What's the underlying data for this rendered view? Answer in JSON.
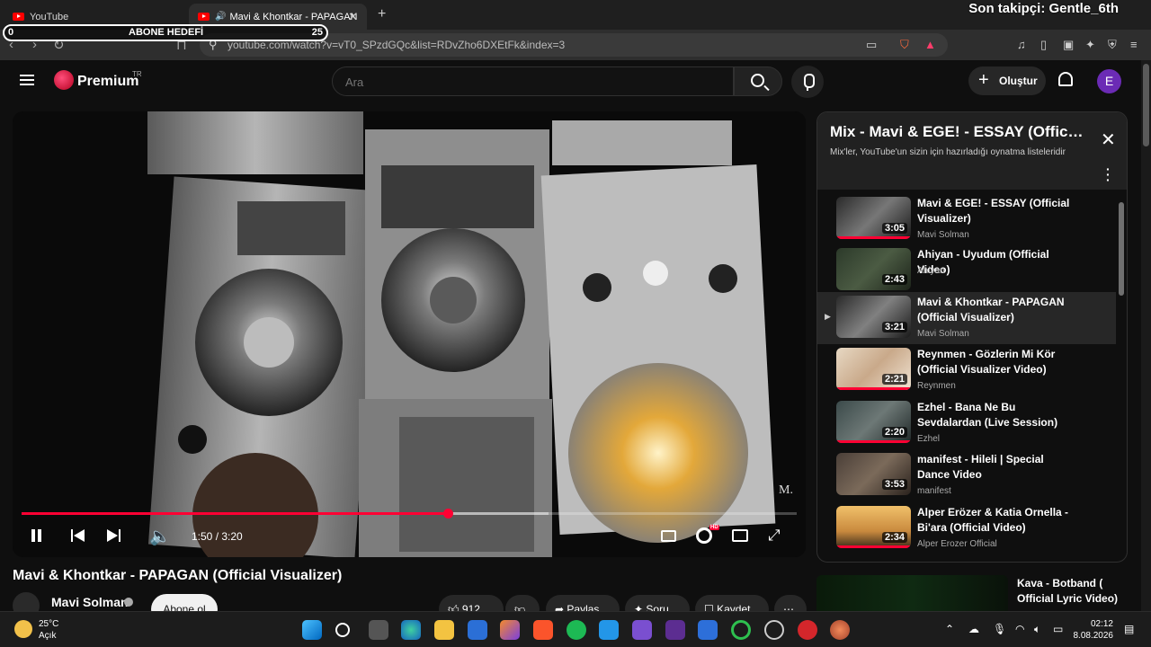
{
  "browser": {
    "tabs": [
      {
        "title": "YouTube"
      },
      {
        "title": "Mavi & Khontkar - PAPAGAN"
      }
    ],
    "new_tab": "+",
    "tab_close": "✕",
    "url": "youtube.com/watch?v=vT0_SPzdGQc&list=RDvZho6DXEtFk&index=3"
  },
  "stream_overlay": {
    "follower_text": "Son takipçi: Gentle_6th",
    "goal_label": "ABONE HEDEFİ",
    "goal_start": "0",
    "goal_target": "25"
  },
  "header": {
    "logo_text": "Premium",
    "logo_country": "TR",
    "search_placeholder": "Ara",
    "create_label": "Oluştur",
    "avatar_letter": "E"
  },
  "player": {
    "watermark": "M.",
    "time": "1:50 / 3:20",
    "progress": 0.55,
    "buffered": 0.68
  },
  "video_info": {
    "title": "Mavi & Khontkar - PAPAGAN (Official Visualizer)",
    "channel": "Mavi Solman",
    "subscribe_label": "Abone ol",
    "like_count": "912",
    "share_label": "Paylaş",
    "ask_label": "Soru",
    "save_label": "Kaydet"
  },
  "playlist": {
    "title": "Mix - Mavi & EGE! - ESSAY (Official ...",
    "subtitle": "Mix'ler, YouTube'un sizin için hazırladığı oynatma listeleridir",
    "items": [
      {
        "title": "Mavi & EGE! - ESSAY (Official Visualizer)",
        "channel": "Mavi Solman",
        "duration": "3:05"
      },
      {
        "title": "Ahiyan - Uyudum (Official Video)",
        "channel": "Ahiyan",
        "duration": "2:43"
      },
      {
        "title": "Mavi & Khontkar - PAPAGAN (Official Visualizer)",
        "channel": "Mavi Solman",
        "duration": "3:21"
      },
      {
        "title": "Reynmen - Gözlerin Mi Kör (Official Visualizer Video)",
        "channel": "Reynmen",
        "duration": "2:21"
      },
      {
        "title": "Ezhel - Bana Ne Bu Sevdalardan (Live Session)",
        "channel": "Ezhel",
        "duration": "2:20"
      },
      {
        "title": "manifest - Hileli | Special Dance Video",
        "channel": "manifest",
        "duration": "3:53"
      },
      {
        "title": "Alper Erözer & Katia Ornella - Bi'ara (Official Video)",
        "channel": "Alper Erozer Official",
        "duration": "2:34"
      }
    ],
    "next_up_title": "Kava - Botband ( Official Lyric Video)"
  },
  "taskbar": {
    "temperature": "25°C",
    "weather": "Açık",
    "time": "02:12",
    "date": "8.08.2026"
  }
}
